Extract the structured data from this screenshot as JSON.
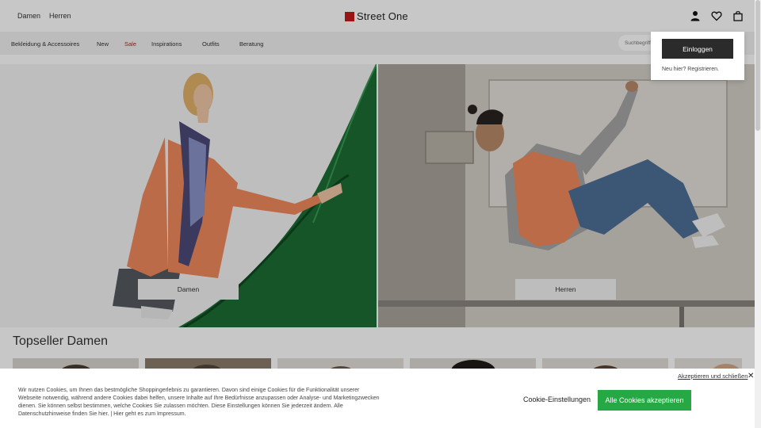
{
  "header": {
    "links": [
      "Damen",
      "Herren"
    ],
    "brand": "Street One",
    "brand_color": "#c41a1a",
    "icons": [
      "user-icon",
      "heart-icon",
      "shopping-bag-icon"
    ]
  },
  "nav": {
    "items": [
      "Bekleidung & Accessoires",
      "New",
      "Sale",
      "Inspirations",
      "Outfits",
      "Beratung"
    ],
    "sale_color": "#c41a1a",
    "search_placeholder": "Suchbegriff"
  },
  "login": {
    "button": "Einloggen",
    "register": "Neu hier? Registrieren."
  },
  "hero": {
    "women_button": "Damen",
    "men_button": "Herren"
  },
  "topseller": {
    "title": "Topseller Damen"
  },
  "cookie": {
    "text": "Wir nutzen Cookies, um Ihnen das bestmögliche Shoppingerlebnis zu garantieren. Davon sind einige Cookies für die Funktionalität unserer Webseite notwendig, während andere Cookies dabei helfen, unsere Inhalte auf Ihre Bedürfnisse anzupassen oder Analyse- und Marketingzwecken dienen. Sie können selbst bestimmen, welche Cookies Sie zulassen möchten. Diese Einstellungen können Sie jederzeit ändern. Alle Datenschutzhinweise finden Sie hier. | Hier geht es zum Impressum.",
    "settings": "Cookie-Einstellungen",
    "accept_all": "Alle Cookies akzeptieren",
    "accept_close": "Akzeptieren und schließen",
    "accept_color": "#26a844"
  }
}
